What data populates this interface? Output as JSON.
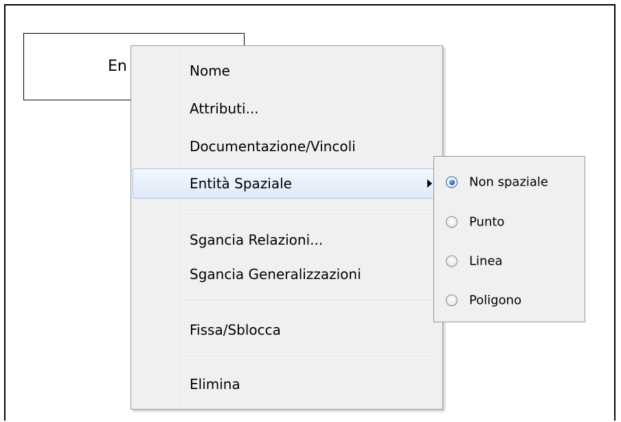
{
  "entity": {
    "label": "En"
  },
  "context_menu": {
    "items": [
      {
        "label": "Nome"
      },
      {
        "label": "Attributi..."
      },
      {
        "label": "Documentazione/Vincoli"
      },
      {
        "label": "Entità Spaziale"
      },
      {
        "label": "Sgancia Relazioni..."
      },
      {
        "label": "Sgancia Generalizzazioni"
      },
      {
        "label": "Fissa/Sblocca"
      },
      {
        "label": "Elimina"
      }
    ]
  },
  "submenu": {
    "options": [
      {
        "label": "Non spaziale",
        "checked": true
      },
      {
        "label": "Punto",
        "checked": false
      },
      {
        "label": "Linea",
        "checked": false
      },
      {
        "label": "Poligono",
        "checked": false
      }
    ]
  },
  "colors": {
    "highlight_border": "#a6c6ee",
    "menu_background": "#f0f0f0"
  }
}
